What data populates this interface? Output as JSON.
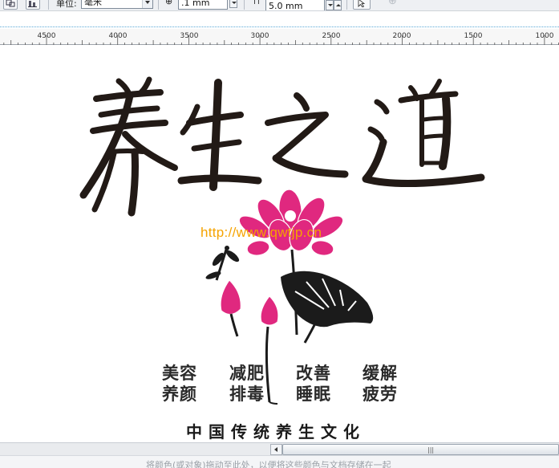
{
  "toolbar": {
    "units_label": "单位:",
    "units_value": "毫米",
    "nudge_value": ".1 mm",
    "duplicate_distance_value": "5.0 mm"
  },
  "ruler": {
    "labels": [
      "4500",
      "4000",
      "3500",
      "3000",
      "2500",
      "2000",
      "1500",
      "1000"
    ]
  },
  "artwork": {
    "title_calligraphy": "养生之道",
    "watermark_url": "http://www.qwtjp.cn",
    "phrases": [
      "美容",
      "减肥",
      "改善",
      "缓解",
      "养颜",
      "排毒",
      "睡眠",
      "疲劳"
    ],
    "footer": "中国传统养生文化",
    "colors": {
      "ink": "#221a16",
      "lotus_pink": "#e0287f",
      "watermark": "#f5a300"
    }
  },
  "scrollbar": {
    "grip_glyph": "|||"
  },
  "status": {
    "hint": "将颜色(或对象)拖动至此处，以便将这些颜色与文档存储在一起"
  }
}
